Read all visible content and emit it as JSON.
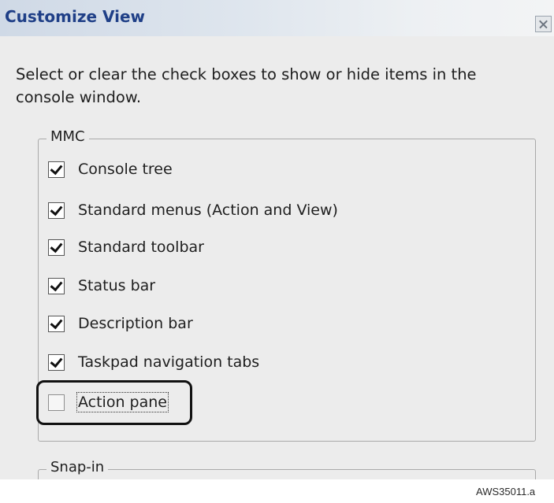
{
  "window": {
    "title": "Customize View",
    "close_icon": "close-x-icon"
  },
  "instructions": {
    "line1": "Select or clear the check boxes to show or hide items in the",
    "line2": "console window."
  },
  "mmc_group": {
    "legend": "MMC",
    "options": [
      {
        "label": "Console tree",
        "checked": true
      },
      {
        "label": "Standard menus (Action and View)",
        "checked": true
      },
      {
        "label": "Standard toolbar",
        "checked": true
      },
      {
        "label": "Status bar",
        "checked": true
      },
      {
        "label": "Description bar",
        "checked": true
      },
      {
        "label": "Taskpad navigation tabs",
        "checked": true
      },
      {
        "label": "Action pane",
        "checked": false
      }
    ]
  },
  "snapin_group": {
    "legend": "Snap-in"
  },
  "figure_code": "AWS35011.a"
}
